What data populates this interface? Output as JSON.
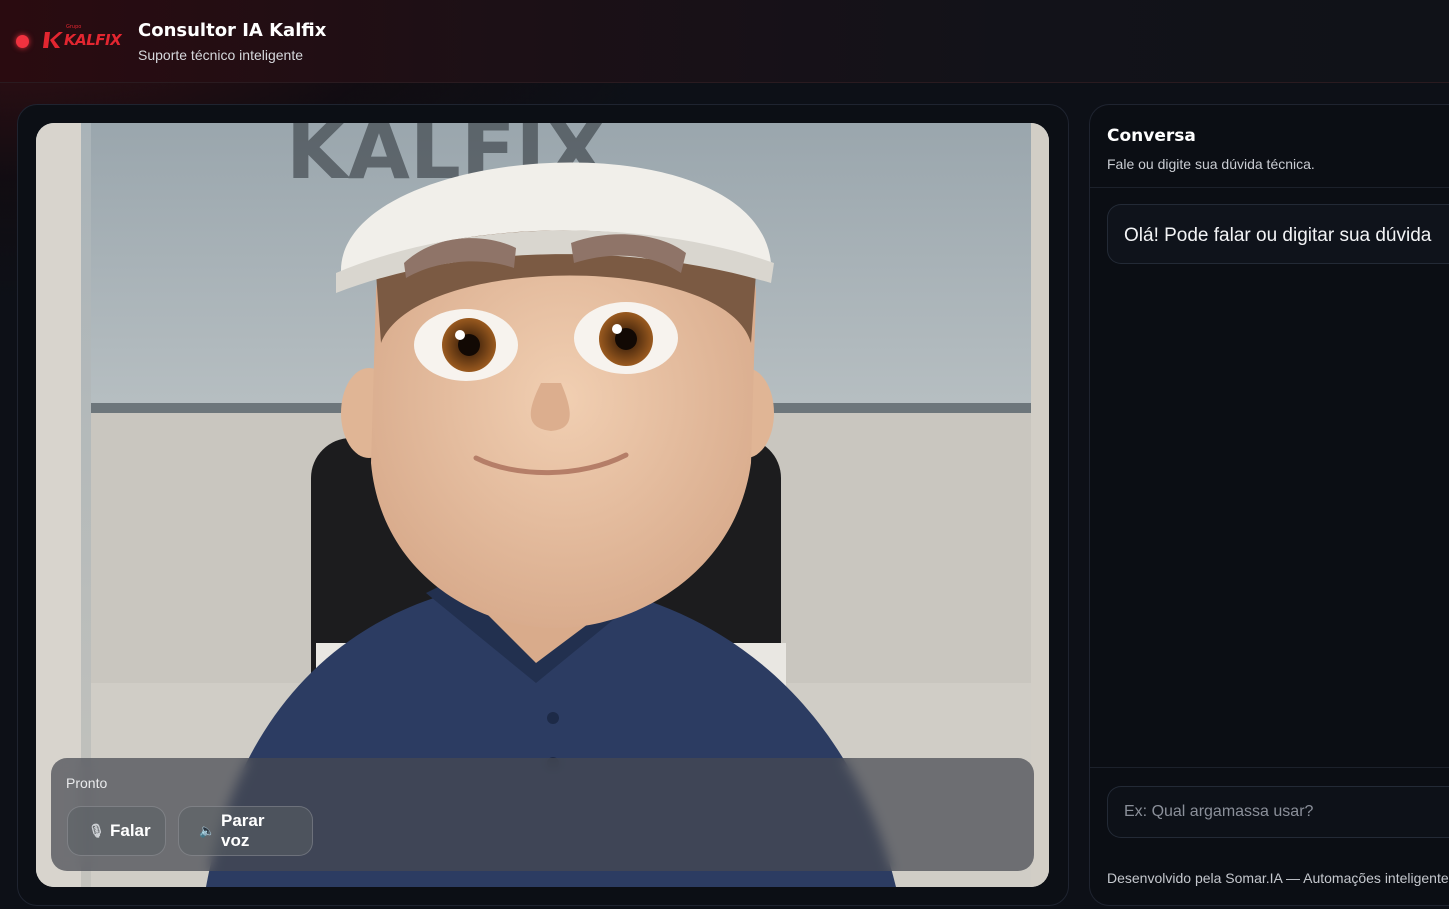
{
  "header": {
    "logo_text": "KALFIX",
    "logo_small_text": "Grupo",
    "title": "Consultor IA Kalfix",
    "subtitle": "Suporte técnico inteligente",
    "status_color": "#f0323f",
    "brand_color": "#e32630"
  },
  "avatar": {
    "backdrop_sign_text": "KALFIX"
  },
  "video_panel": {
    "status": "Pronto",
    "buttons": [
      {
        "label": "Falar",
        "icon": "microphone-icon"
      },
      {
        "label": "Parar voz",
        "icon": "speaker-icon"
      }
    ]
  },
  "chat": {
    "title": "Conversa",
    "subtitle": "Fale ou digite sua dúvida técnica.",
    "messages": [
      {
        "role": "assistant",
        "text": "Olá! Pode falar ou digitar sua dúvida"
      }
    ],
    "input": {
      "value": "",
      "placeholder": "Ex: Qual argamassa usar?"
    },
    "footer": "Desenvolvido pela Somar.IA — Automações inteligentes"
  }
}
